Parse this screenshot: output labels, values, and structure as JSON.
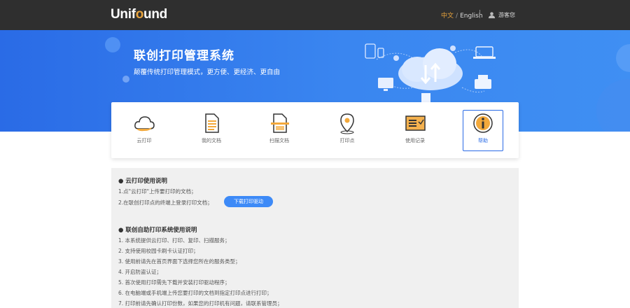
{
  "header": {
    "logo_prefix": "Unif",
    "logo_dot": "o",
    "logo_suffix": "und",
    "lang_zh": "中文",
    "lang_sep": "/",
    "lang_en": "English",
    "username": "游客您"
  },
  "banner": {
    "title": "联创打印管理系统",
    "subtitle": "颠覆传统打印管理模式，更方便、更经济、更自由"
  },
  "menu": {
    "items": [
      {
        "label": "云打印",
        "icon": "cloud-icon"
      },
      {
        "label": "我的文档",
        "icon": "document-icon"
      },
      {
        "label": "扫描文档",
        "icon": "scan-icon"
      },
      {
        "label": "打印点",
        "icon": "location-pin-icon"
      },
      {
        "label": "使用记录",
        "icon": "record-icon"
      },
      {
        "label": "帮助",
        "icon": "info-icon"
      }
    ]
  },
  "help": {
    "section1_title": "● 云打印使用说明",
    "section1_lines": [
      "1.点\"云打印\"上传要打印的文档；",
      "2.在联创打印点的终端上登录打印文档；"
    ],
    "download_button": "下载打印驱动",
    "section2_title": "● 联创自助打印系统使用说明",
    "section2_lines": [
      "1. 本系统提供云打印、打印、复印、扫描服务；",
      "2. 支持使用校园卡刷卡认证打印；",
      "3. 使用前请先在首页界面下选择您所在的服务类型；",
      "4. 开启防盗认证；",
      "5. 首次使用打印需先下载并安装打印驱动程序；",
      "6. 在电脑端或手机端上传您要打印的文档到指定打印点进行打印；",
      "7. 打印前请先确认打印份数，如果您的打印机有问题，请联系管理员；"
    ]
  },
  "colors": {
    "topbar": "#2f2f2f",
    "brand_blue": "#2a6be6",
    "accent_orange": "#e8a33c"
  }
}
